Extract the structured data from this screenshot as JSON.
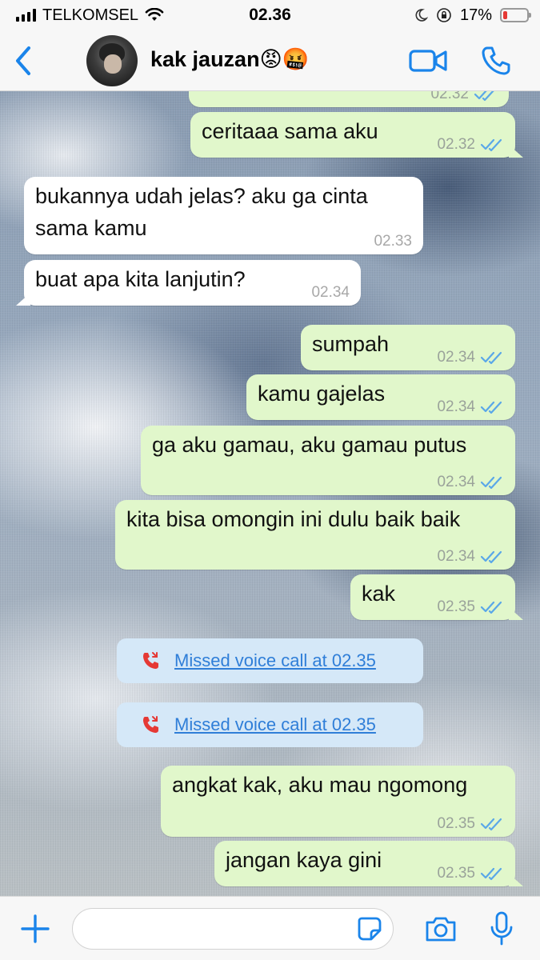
{
  "status_bar": {
    "carrier": "TELKOMSEL",
    "time": "02.36",
    "battery_percent": "17%",
    "battery_level": 0.17,
    "icons": [
      "signal-icon",
      "wifi-icon",
      "moon-icon",
      "orientation-lock-icon",
      "battery-icon"
    ]
  },
  "header": {
    "contact_name": "kak jauzan",
    "emoji": "😡🤬",
    "icons": [
      "back-icon",
      "avatar",
      "video-call-icon",
      "voice-call-icon"
    ],
    "accent_color": "#1a84ea"
  },
  "messages": [
    {
      "dir": "out",
      "text": "",
      "time": "02.32",
      "ticks": "read"
    },
    {
      "dir": "out",
      "text": "ceritaaa sama aku",
      "time": "02.32",
      "ticks": "read"
    },
    {
      "dir": "in",
      "text": "bukannya udah jelas? aku ga cinta sama kamu",
      "time": "02.33"
    },
    {
      "dir": "in",
      "text": "buat apa kita lanjutin?",
      "time": "02.34"
    },
    {
      "dir": "out",
      "text": "sumpah",
      "time": "02.34",
      "ticks": "read"
    },
    {
      "dir": "out",
      "text": "kamu gajelas",
      "time": "02.34",
      "ticks": "read"
    },
    {
      "dir": "out",
      "text": "ga aku gamau, aku gamau putus",
      "time": "02.34",
      "ticks": "read"
    },
    {
      "dir": "out",
      "text": "kita bisa omongin ini dulu baik baik",
      "time": "02.34",
      "ticks": "read"
    },
    {
      "dir": "out",
      "text": "kak",
      "time": "02.35",
      "ticks": "read"
    },
    {
      "dir": "out",
      "text": "angkat kak, aku mau ngomong",
      "time": "02.35",
      "ticks": "read"
    },
    {
      "dir": "out",
      "text": "jangan kaya gini",
      "time": "02.35",
      "ticks": "read"
    }
  ],
  "msg_line2": {
    "m2a": "bukannya udah jelas? aku ga cinta",
    "m2b": "sama kamu"
  },
  "missed_calls": [
    {
      "text": "Missed voice call at 02.35",
      "icon": "missed-call-icon"
    },
    {
      "text": "Missed voice call at 02.35",
      "icon": "missed-call-icon"
    }
  ],
  "input_bar": {
    "placeholder": "",
    "icons": [
      "plus-icon",
      "sticker-icon",
      "camera-icon",
      "microphone-icon"
    ]
  },
  "colors": {
    "outgoing_bubble": "#e1f7cb",
    "incoming_bubble": "#ffffff",
    "read_ticks": "#5aa7e8",
    "missed_call_bg": "#d5e8f8",
    "missed_call_text": "#2f7ed8",
    "missed_call_icon": "#e53935"
  }
}
